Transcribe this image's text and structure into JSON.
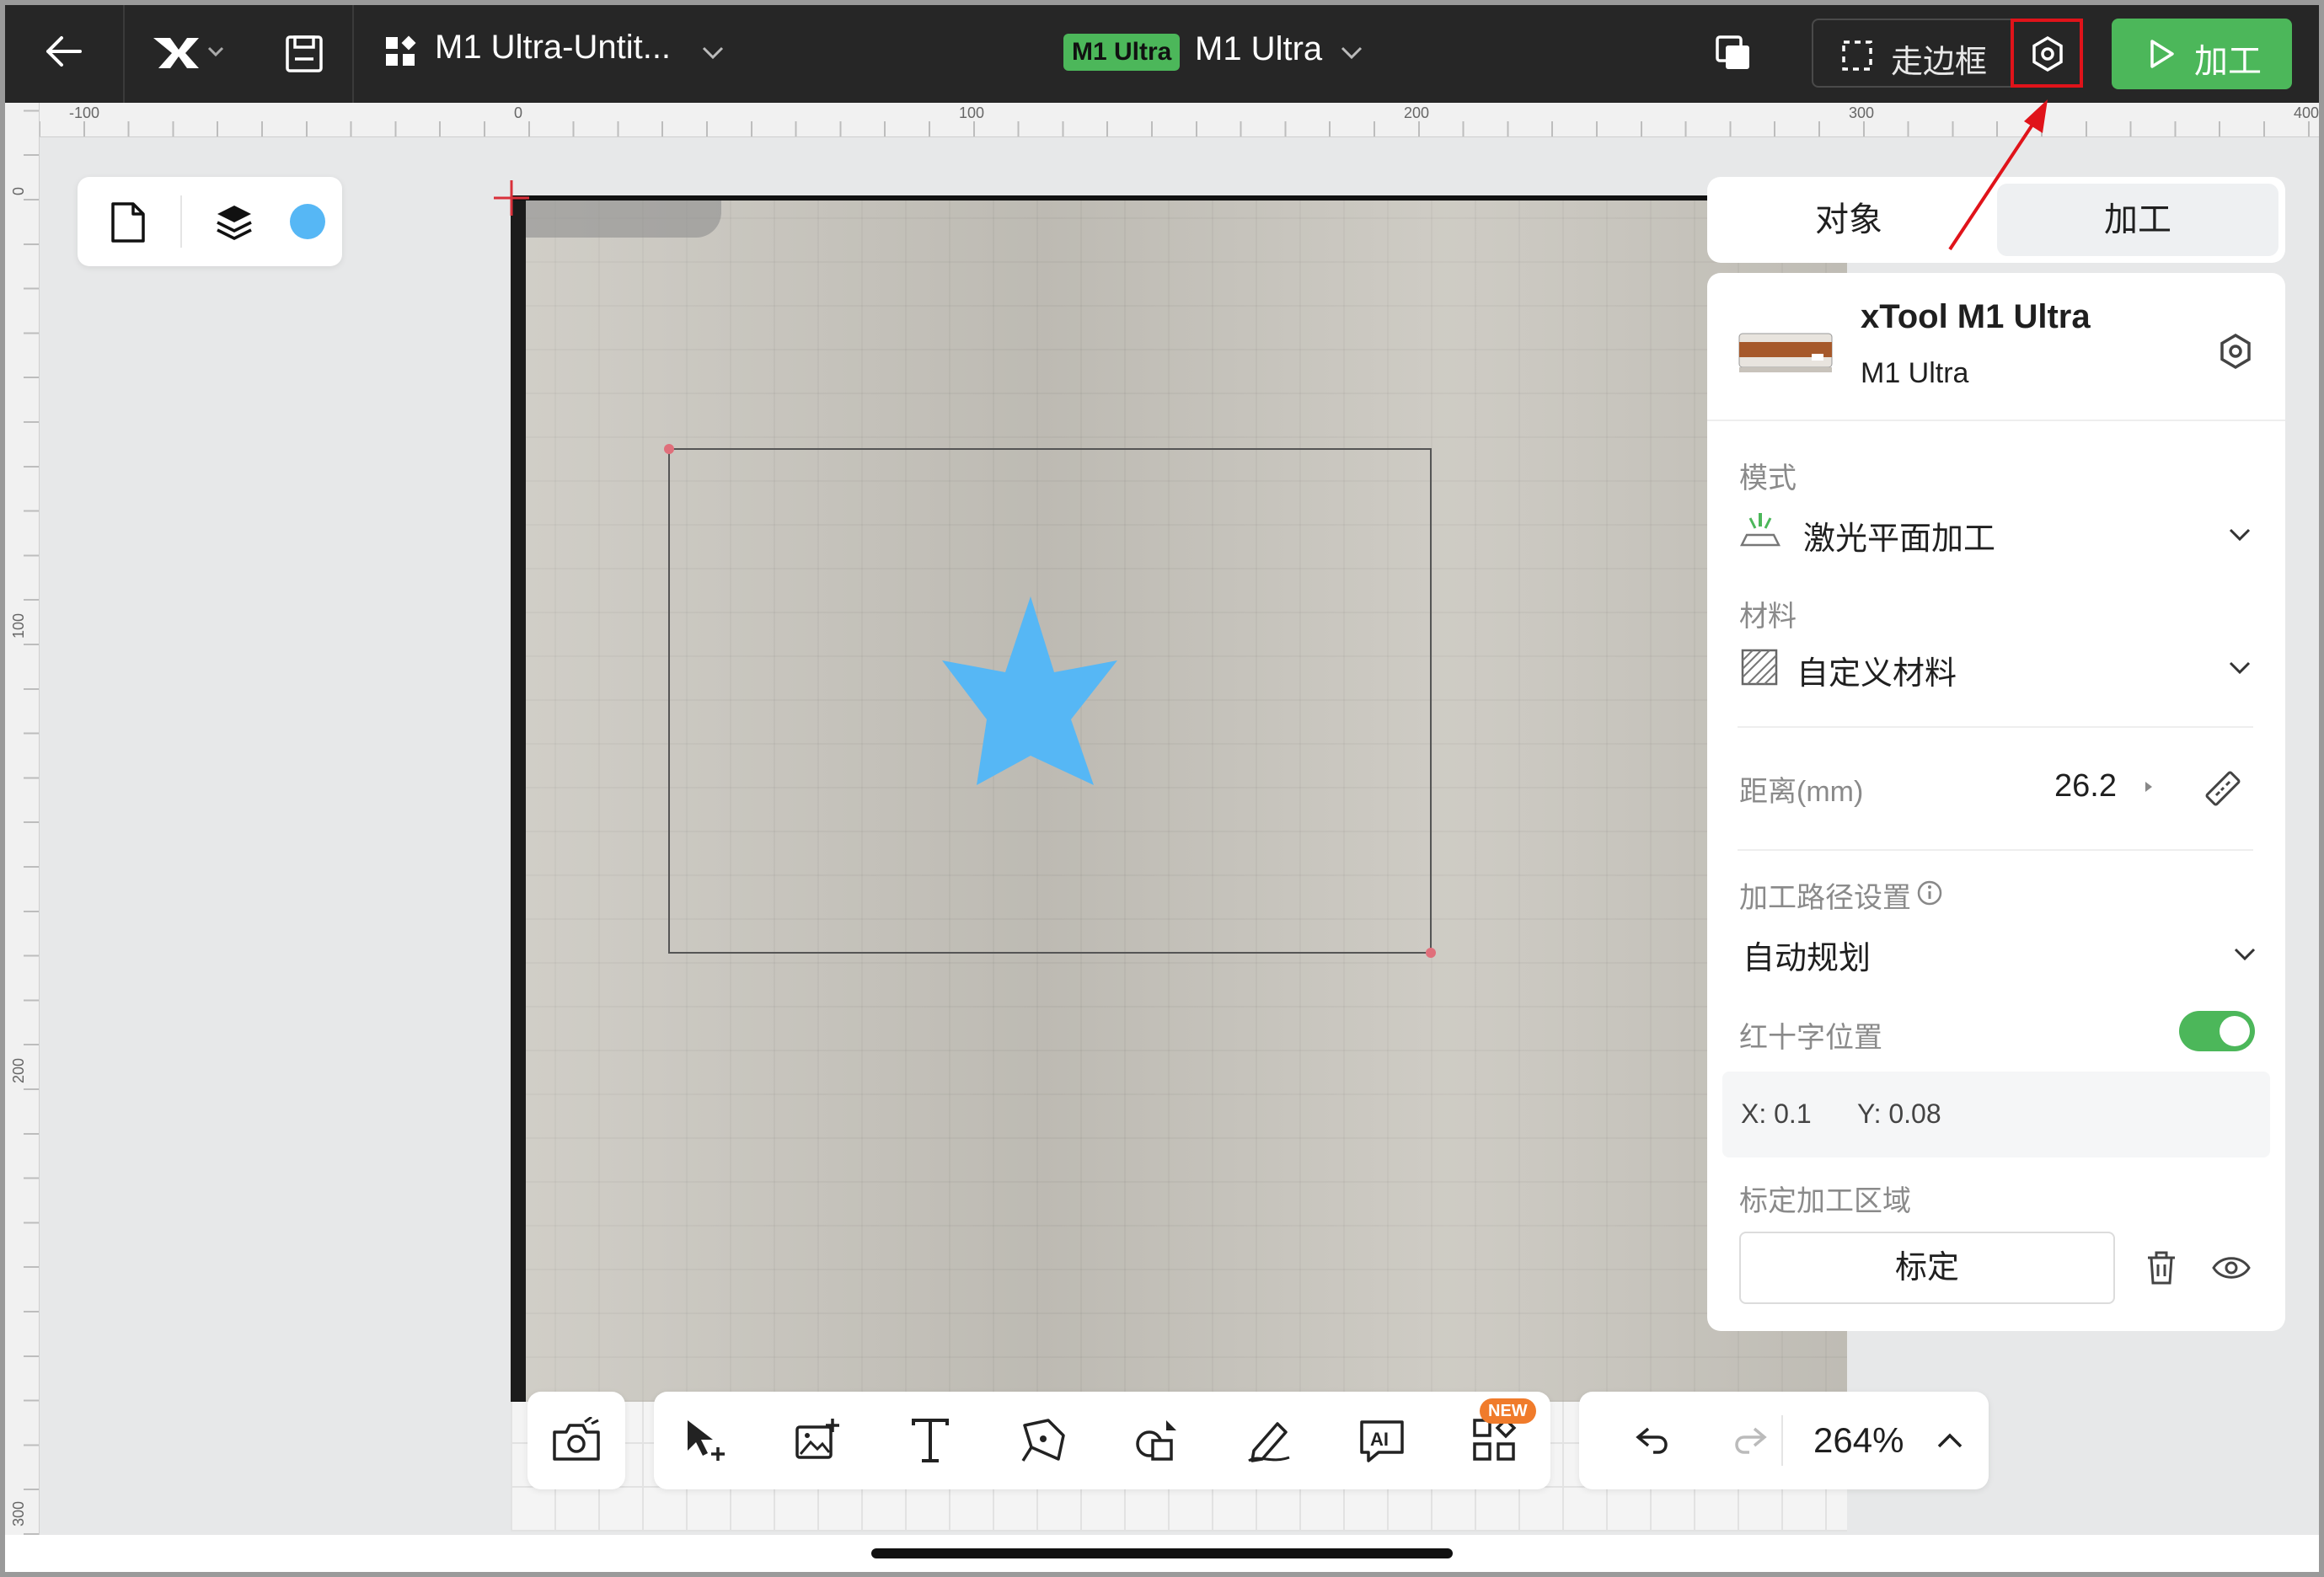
{
  "topbar": {
    "project_title": "M1 Ultra-Untit...",
    "machine_badge": "M1 Ultra",
    "machine_name": "M1 Ultra",
    "frame_label": "走边框",
    "run_label": "加工"
  },
  "rulers": {
    "h_ticks": [
      "-100",
      "0",
      "100",
      "200",
      "300",
      "400"
    ],
    "v_ticks": [
      "0",
      "100",
      "200",
      "300"
    ]
  },
  "panel": {
    "tabs": [
      "对象",
      "加工"
    ],
    "active_tab": "加工",
    "device_name": "xTool M1 Ultra",
    "device_model": "M1 Ultra",
    "mode_label": "模式",
    "mode_value": "激光平面加工",
    "material_label": "材料",
    "material_value": "自定义材料",
    "distance_label": "距离(mm)",
    "distance_value": "26.2",
    "path_label": "加工路径设置",
    "path_value": "自动规划",
    "crosshair_label": "红十字位置",
    "crosshair_enabled": true,
    "crosshair_x": "X: 0.1",
    "crosshair_y": "Y: 0.08",
    "calib_label": "标定加工区域",
    "calib_button": "标定"
  },
  "toolbar": {
    "new_badge": "NEW",
    "zoom": "264%"
  },
  "colors": {
    "accent_green": "#4cb75a",
    "star_blue": "#56b7f5",
    "highlight_red": "#e0131a",
    "dark_bar": "#262626"
  }
}
